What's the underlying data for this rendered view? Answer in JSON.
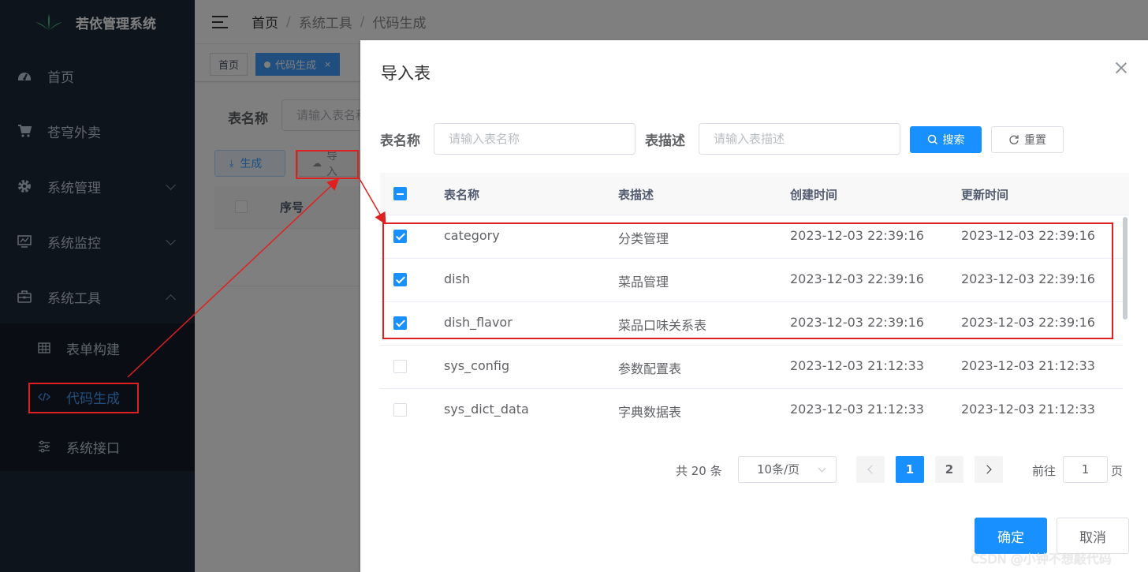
{
  "app": {
    "title": "若依管理系统"
  },
  "sidebar": {
    "items": [
      {
        "label": "首页",
        "icon": "dashboard-icon"
      },
      {
        "label": "苍穹外卖",
        "icon": "cart-icon"
      },
      {
        "label": "系统管理",
        "icon": "gear-icon",
        "expandable": true
      },
      {
        "label": "系统监控",
        "icon": "monitor-icon",
        "expandable": true
      },
      {
        "label": "系统工具",
        "icon": "toolbox-icon",
        "expanded": true
      }
    ],
    "subitems": [
      {
        "label": "表单构建",
        "icon": "grid-icon"
      },
      {
        "label": "代码生成",
        "icon": "code-icon",
        "active": true
      },
      {
        "label": "系统接口",
        "icon": "sliders-icon"
      }
    ]
  },
  "navbar": {
    "breadcrumb": [
      "首页",
      "系统工具",
      "代码生成"
    ],
    "separator": "/"
  },
  "tags": [
    {
      "label": "首页"
    },
    {
      "label": "代码生成",
      "active": true,
      "close": "×"
    }
  ],
  "background_page": {
    "form_label": "表名称",
    "input_placeholder": "请输入表名称",
    "generate_label": "生成",
    "import_label": "导入",
    "seq_header": "序号"
  },
  "dialog": {
    "title": "导入表",
    "form": {
      "table_name_label": "表名称",
      "table_name_placeholder": "请输入表名称",
      "table_desc_label": "表描述",
      "table_desc_placeholder": "请输入表描述",
      "search_label": "搜索",
      "reset_label": "重置"
    },
    "table": {
      "headers": [
        "表名称",
        "表描述",
        "创建时间",
        "更新时间"
      ],
      "rows": [
        {
          "checked": true,
          "name": "category",
          "desc": "分类管理",
          "created": "2023-12-03 22:39:16",
          "updated": "2023-12-03 22:39:16"
        },
        {
          "checked": true,
          "name": "dish",
          "desc": "菜品管理",
          "created": "2023-12-03 22:39:16",
          "updated": "2023-12-03 22:39:16"
        },
        {
          "checked": true,
          "name": "dish_flavor",
          "desc": "菜品口味关系表",
          "created": "2023-12-03 22:39:16",
          "updated": "2023-12-03 22:39:16"
        },
        {
          "checked": false,
          "name": "sys_config",
          "desc": "参数配置表",
          "created": "2023-12-03 21:12:33",
          "updated": "2023-12-03 21:12:33"
        },
        {
          "checked": false,
          "name": "sys_dict_data",
          "desc": "字典数据表",
          "created": "2023-12-03 21:12:33",
          "updated": "2023-12-03 21:12:33"
        }
      ]
    },
    "pagination": {
      "total_text": "共 20 条",
      "page_size": "10条/页",
      "pages": [
        "1",
        "2"
      ],
      "current_page": "1",
      "goto_prefix": "前往",
      "goto_value": "1",
      "goto_suffix": "页"
    },
    "confirm_label": "确定",
    "cancel_label": "取消"
  },
  "watermark": "CSDN @小钟不想敲代码",
  "colors": {
    "primary": "#1890ff",
    "sidebar_bg": "#1d2838",
    "annotation_red": "#e02020"
  }
}
